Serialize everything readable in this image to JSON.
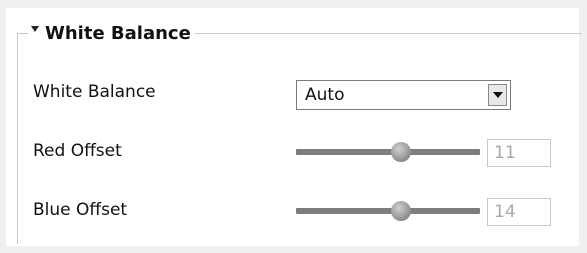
{
  "section": {
    "title": "White Balance",
    "collapse_icon": "triangle-down-icon"
  },
  "fields": {
    "white_balance": {
      "label": "White Balance",
      "value": "Auto",
      "dropdown_icon": "chevron-down-icon"
    },
    "red_offset": {
      "label": "Red Offset",
      "value": "11",
      "slider_fraction": 0.57
    },
    "blue_offset": {
      "label": "Blue Offset",
      "value": "14",
      "slider_fraction": 0.57
    }
  }
}
